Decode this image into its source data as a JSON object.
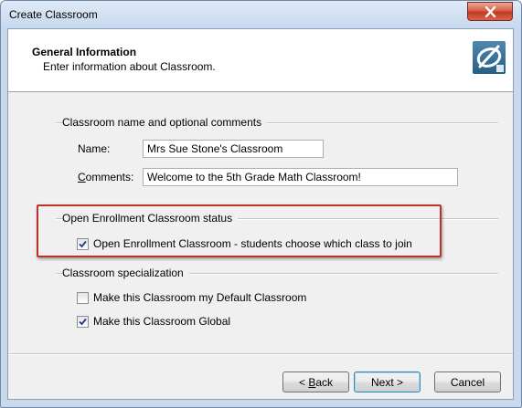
{
  "window": {
    "title": "Create Classroom"
  },
  "header": {
    "title": "General Information",
    "subtitle": "Enter information about Classroom."
  },
  "name_group": {
    "label": "Classroom name and optional comments",
    "name_label": "Name:",
    "name_value": "Mrs Sue Stone's Classroom",
    "comments_label_first": "C",
    "comments_label_rest": "omments:",
    "comments_value": "Welcome to the 5th Grade Math Classroom!"
  },
  "enrollment_group": {
    "label": "Open Enrollment Classroom status",
    "open_enrollment": {
      "label": "Open Enrollment Classroom - students choose which class to join",
      "checked": true
    }
  },
  "specialization_group": {
    "label": "Classroom specialization",
    "default_classroom": {
      "label": "Make this Classroom my Default Classroom",
      "checked": false
    },
    "global_classroom": {
      "label": "Make this Classroom Global",
      "checked": true
    }
  },
  "buttons": {
    "back_prefix": "< ",
    "back_accel": "B",
    "back_rest": "ack",
    "next": "Next >",
    "cancel": "Cancel"
  },
  "colors": {
    "highlight": "#c0302a",
    "checkmark": "#1d3a8a",
    "close": "#c23a22"
  }
}
